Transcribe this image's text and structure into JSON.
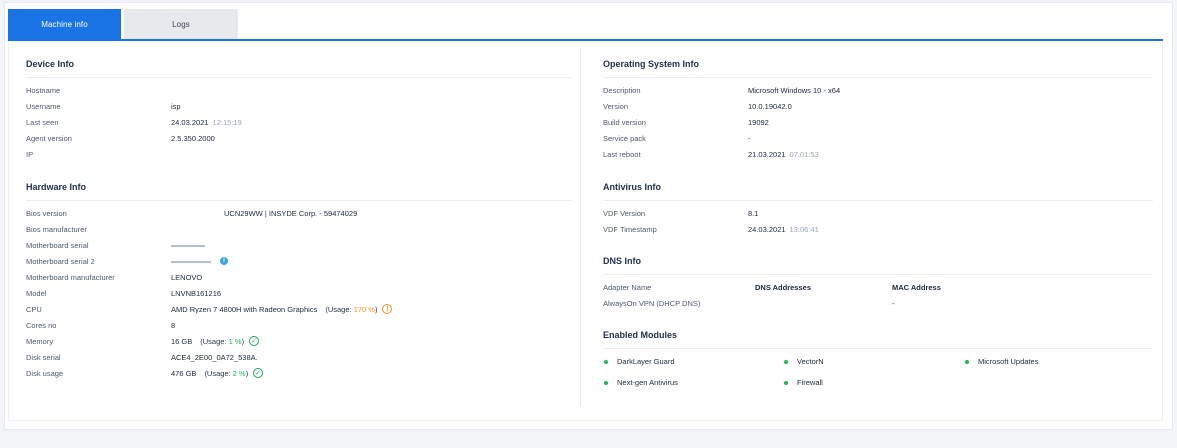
{
  "tabs": [
    {
      "label": "Machine info",
      "active": true
    },
    {
      "label": "Logs",
      "active": false
    }
  ],
  "device_info": {
    "title": "Device Info",
    "hostname_label": "Hostname",
    "hostname": "",
    "username_label": "Username",
    "username": "isp",
    "last_seen_label": "Last seen",
    "last_seen_date": "24.03.2021",
    "last_seen_time": "12:15:19",
    "agent_version_label": "Agent version",
    "agent_version": "2.5.350.2000",
    "ip_label": "IP",
    "ip": ""
  },
  "hardware_info": {
    "title": "Hardware Info",
    "bios_version_label": "Bios version",
    "bios_version": "UCN29WW | INSYDE Corp. - 59474029",
    "bios_manufacturer_label": "Bios manufacturer",
    "bios_manufacturer": "",
    "mb_serial_label": "Motherboard serial",
    "mb_serial2_label": "Motherboard serial 2",
    "mb_manufacturer_label": "Motherboard manufacturer",
    "mb_manufacturer": "LENOVO",
    "model_label": "Model",
    "model": "LNVNB161216",
    "cpu_label": "CPU",
    "cpu": "AMD Ryzen 7 4800H with Radeon Graphics",
    "cpu_usage_prefix": "(Usage:",
    "cpu_usage_pct": "170 %",
    "cpu_usage_suffix": ")",
    "cores_label": "Cores no",
    "cores": "8",
    "memory_label": "Memory",
    "memory": "16 GB",
    "memory_usage_prefix": "(Usage:",
    "memory_usage_pct": "1 %",
    "memory_usage_suffix": ")",
    "disk_serial_label": "Disk serial",
    "disk_serial": "ACE4_2E00_0A72_538A.",
    "disk_usage_label": "Disk usage",
    "disk_usage": "476 GB",
    "disk_usage_prefix": "(Usage:",
    "disk_usage_pct": "2 %",
    "disk_usage_suffix": ")"
  },
  "os_info": {
    "title": "Operating System Info",
    "description_label": "Description",
    "description": "Microsoft Windows 10 - x64",
    "version_label": "Version",
    "version": "10.0.19042.0",
    "build_label": "Build version",
    "build": "19092",
    "service_pack_label": "Service pack",
    "service_pack": "-",
    "last_reboot_label": "Last reboot",
    "last_reboot_date": "21.03.2021",
    "last_reboot_time": "07:01:53"
  },
  "antivirus_info": {
    "title": "Antivirus Info",
    "vdf_version_label": "VDF Version",
    "vdf_version": "8.1",
    "vdf_timestamp_label": "VDF Timestamp",
    "vdf_timestamp_date": "24.03.2021",
    "vdf_timestamp_time": "13:06:41"
  },
  "dns_info": {
    "title": "DNS Info",
    "headers": [
      "Adapter Name",
      "DNS Addresses",
      "MAC Address"
    ],
    "rows": [
      {
        "adapter": "AlwaysOn VPN (DHCP DNS)",
        "dns": "",
        "mac": "-"
      }
    ]
  },
  "enabled_modules": {
    "title": "Enabled Modules",
    "items": [
      "DarkLayer Guard",
      "VectorN",
      "Microsoft Updates",
      "Next-gen Antivirus",
      "Firewall"
    ]
  },
  "colors": {
    "accent": "#1a74e6",
    "ok": "#23a65a",
    "warn": "#f0902a",
    "info": "#3ea3e6",
    "module_dot": "#23b55a"
  },
  "icons": {
    "cpu_status": "warning-circle-icon",
    "memory_status": "check-circle-icon",
    "disk_status": "check-circle-icon",
    "serial_info": "info-icon"
  }
}
